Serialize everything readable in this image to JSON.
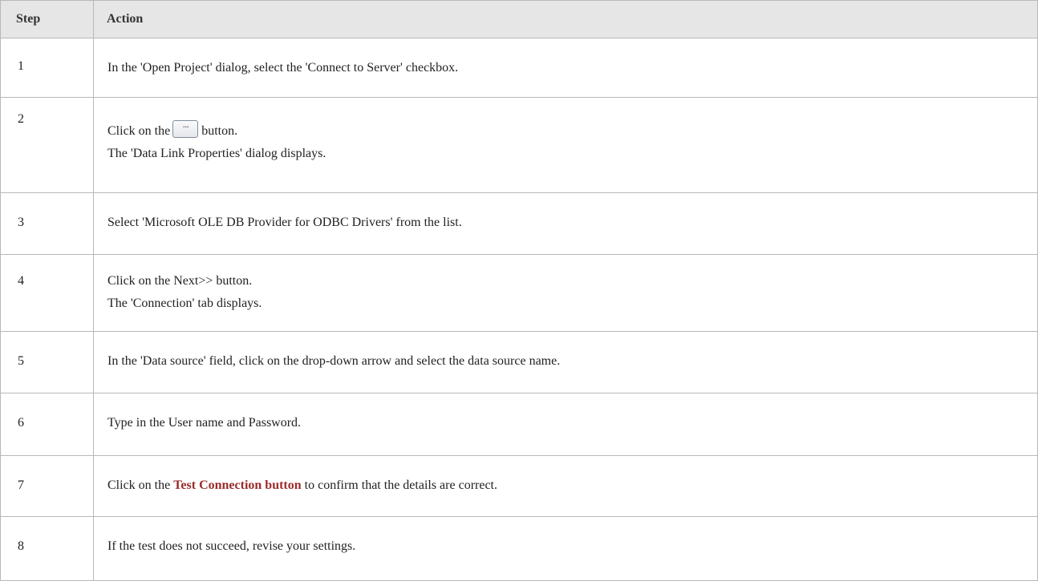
{
  "headers": {
    "step": "Step",
    "action": "Action"
  },
  "rows": [
    {
      "step": "1",
      "line1": "In the 'Open Project' dialog, select the 'Connect to Server' checkbox."
    },
    {
      "step": "2",
      "line1_before": "Click on the",
      "button_icon": "ellipsis-button-icon",
      "button_glyph": "···",
      "line1_after": "button.",
      "line2": "The 'Data Link Properties' dialog displays."
    },
    {
      "step": "3",
      "line1": "Select 'Microsoft OLE DB Provider for ODBC Drivers' from the list."
    },
    {
      "step": "4",
      "line1": "Click on the Next>> button.",
      "line2": "The 'Connection' tab displays."
    },
    {
      "step": "5",
      "line1": "In the 'Data source' field, click on the drop-down arrow and select the data source name."
    },
    {
      "step": "6",
      "line1": "Type in the User name and Password."
    },
    {
      "step": "7",
      "line1_before": "Click on the",
      "link": "Test Connection button",
      "line1_after": "to confirm that the details are correct."
    },
    {
      "step": "8",
      "line1": "If the test does not succeed, revise your settings."
    }
  ],
  "colors": {
    "header_bg": "#e6e6e6",
    "link": "#9c2b2b",
    "border": "#b8b8b8"
  }
}
